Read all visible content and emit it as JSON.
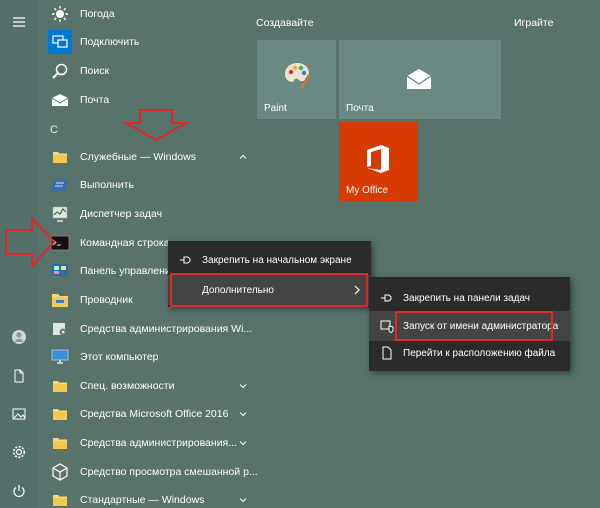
{
  "rail": {
    "icons": [
      "hamburger-icon",
      "user-avatar-icon",
      "document-icon",
      "pictures-icon",
      "settings-icon",
      "power-icon"
    ]
  },
  "applist": {
    "items_top": [
      {
        "label": "Погода",
        "icon": "sun-icon"
      },
      {
        "label": "Подключить",
        "icon": "connect-icon"
      },
      {
        "label": "Поиск",
        "icon": "search-icon"
      },
      {
        "label": "Почта",
        "icon": "mail-icon"
      }
    ],
    "section_letter": "С",
    "folder_expanded": {
      "label": "Служебные — Windows",
      "icon": "folder-icon"
    },
    "subitems": [
      {
        "label": "Выполнить",
        "icon": "run-icon"
      },
      {
        "label": "Диспетчер задач",
        "icon": "task-manager-icon"
      },
      {
        "label": "Командная строка",
        "icon": "cmd-icon"
      },
      {
        "label": "Панель управления",
        "icon": "control-panel-icon"
      },
      {
        "label": "Проводник",
        "icon": "explorer-icon"
      },
      {
        "label": "Средства администрирования Wi...",
        "icon": "admin-tools-icon"
      },
      {
        "label": "Этот компьютер",
        "icon": "computer-icon"
      }
    ],
    "folders": [
      {
        "label": "Спец. возможности",
        "icon": "folder-icon"
      },
      {
        "label": "Средства Microsoft Office 2016",
        "icon": "folder-icon"
      },
      {
        "label": "Средства администрирования...",
        "icon": "folder-icon"
      },
      {
        "label": "Средство просмотра смешанной р...",
        "icon": "mixed-reality-icon"
      },
      {
        "label": "Стандартные — Windows",
        "icon": "folder-icon"
      }
    ]
  },
  "tiles": {
    "group_create": "Создавайте",
    "group_play": "Играйте",
    "paint": "Paint",
    "mail": "Почта",
    "office": "My Office",
    "office_color": "#d83b01"
  },
  "context_menu": {
    "pin_start": "Закрепить на начальном экране",
    "more": "Дополнительно"
  },
  "submenu": {
    "pin_taskbar": "Закрепить на панели задач",
    "run_as_admin": "Запуск от имени администратора",
    "open_location": "Перейти к расположению файла"
  },
  "colors": {
    "accent_red": "#e2262a"
  }
}
